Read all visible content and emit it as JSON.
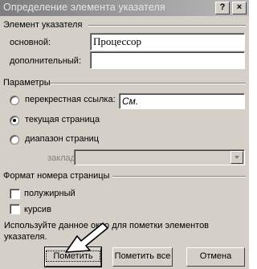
{
  "window": {
    "title": "Определение элемента указателя",
    "help_label": "?",
    "close_label": "×"
  },
  "entry": {
    "section_label": "Элемент указателя",
    "main_label": "основной:",
    "main_value": "Процессор",
    "sub_label": "дополнительный:",
    "sub_value": ""
  },
  "options": {
    "section_label": "Параметры",
    "cross_ref_label": "перекрестная ссылка:",
    "cross_ref_value": "См.",
    "current_page_label": "текущая страница",
    "page_range_label": "диапазон страниц",
    "bookmark_label": "закладка:",
    "bookmark_value": "",
    "selected": "current_page"
  },
  "format": {
    "section_label": "Формат номера страницы",
    "bold_label": "полужирный",
    "bold_checked": false,
    "italic_label": "курсив",
    "italic_checked": false
  },
  "hint": {
    "line1": "Используйте данное окно для пометки элементов",
    "line2": "указателя."
  },
  "buttons": {
    "mark_label": "Пометить",
    "mark_all_label": "Пометить все",
    "cancel_label": "Отмена"
  }
}
